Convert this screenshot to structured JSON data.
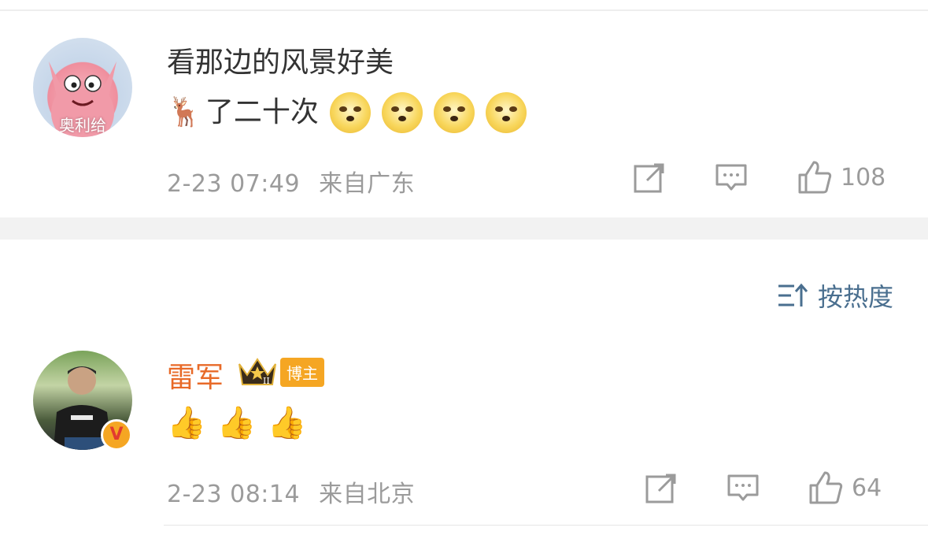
{
  "comments": [
    {
      "avatar_label": "奥利给",
      "text_line1": "看那边的风景好美",
      "text_line2": "了二十次",
      "emojis": [
        "deer-emoji",
        "doge-emoji",
        "doge-emoji",
        "doge-emoji",
        "doge-emoji"
      ],
      "deer": "🦌",
      "time": "2-23 07:49",
      "location": "来自广东",
      "like_count": "108"
    },
    {
      "username": "雷军",
      "badge_label": "博主",
      "emojis": [
        "thumbs-up",
        "thumbs-up",
        "thumbs-up"
      ],
      "thumb": "👍",
      "time": "2-23 08:14",
      "location": "来自北京",
      "like_count": "64"
    }
  ],
  "sort": {
    "label": "按热度"
  },
  "colors": {
    "username": "#e86a28",
    "meta": "#9b9b9b",
    "sort": "#4a6f8f",
    "badge": "#f5a623"
  }
}
